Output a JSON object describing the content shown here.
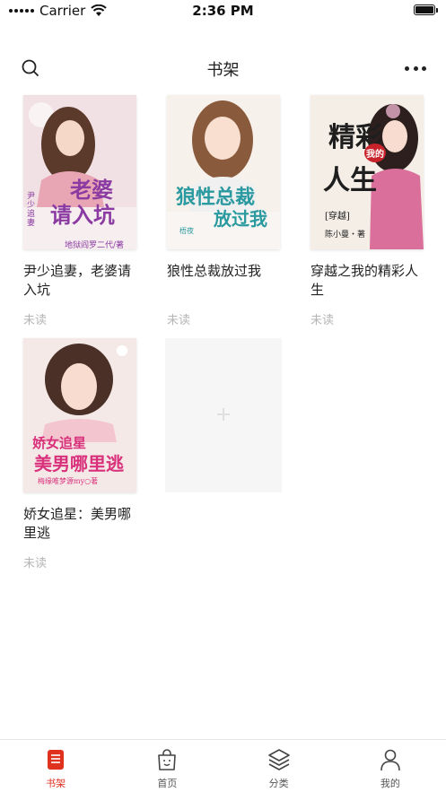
{
  "status_bar": {
    "carrier": "Carrier",
    "time": "2:36 PM"
  },
  "nav": {
    "title": "书架",
    "search_icon": "search-icon",
    "more_icon": "more-dots-icon"
  },
  "books": [
    {
      "title": "尹少追妻，老婆请入坑",
      "status": "未读",
      "cover": {
        "main_line1": "老婆",
        "main_line2": "请入坑",
        "series": "尹少追妻",
        "author": "地狱阎罗二代/著",
        "bg": "#f3e6ea",
        "accent": "#8a3aa0"
      }
    },
    {
      "title": "狼性总裁放过我",
      "status": "未读",
      "cover": {
        "main_line1": "狼性总裁",
        "main_line2": "放过我",
        "publisher": "梧夜",
        "bg": "#f7f2ee",
        "accent": "#2a9aa0"
      }
    },
    {
      "title": "穿越之我的精彩人生",
      "status": "未读",
      "cover": {
        "main_line1": "精彩",
        "main_line2": "人生",
        "badge": "我的",
        "series": "[穿越]",
        "author": "陈小曼・著",
        "bg": "#f4efe9",
        "accent": "#1e1e1e"
      }
    },
    {
      "title": "娇女追星：美男哪里逃",
      "status": "未读",
      "cover": {
        "main_line1": "娇女追星",
        "main_line2": "美男哪里逃",
        "author": "梅缘唯梦源my○著",
        "bg": "#f6ecec",
        "accent": "#d8307a"
      }
    }
  ],
  "add_card": {
    "icon": "plus-icon"
  },
  "tabs": [
    {
      "label": "书架",
      "icon": "bookshelf-icon",
      "active": true
    },
    {
      "label": "首页",
      "icon": "shopping-bag-icon",
      "active": false
    },
    {
      "label": "分类",
      "icon": "layers-icon",
      "active": false
    },
    {
      "label": "我的",
      "icon": "person-icon",
      "active": false
    }
  ],
  "colors": {
    "accent": "#e0301e",
    "muted": "#b5b5b5",
    "text": "#222222"
  }
}
